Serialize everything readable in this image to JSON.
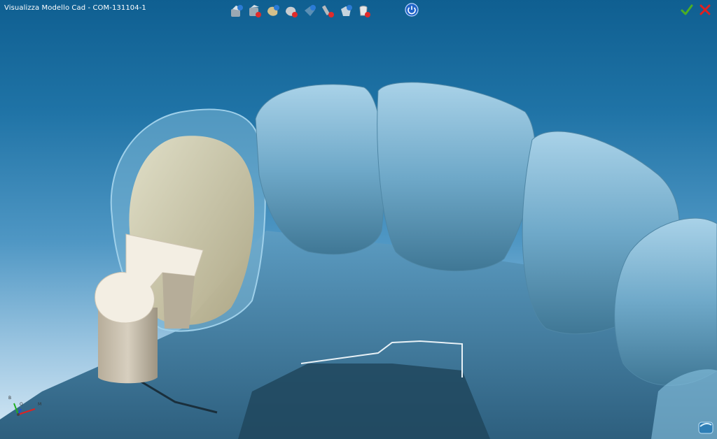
{
  "window": {
    "title": "Visualizza Modello Cad  - COM-131104-1"
  },
  "toolbar": {
    "tools": [
      {
        "icon": "model-view-icon"
      },
      {
        "icon": "model-remove-icon"
      },
      {
        "icon": "crown-view-icon"
      },
      {
        "icon": "crown-remove-icon"
      },
      {
        "icon": "abutment-view-icon"
      },
      {
        "icon": "implant-remove-icon"
      },
      {
        "icon": "scanbody-view-icon"
      },
      {
        "icon": "antagonist-remove-icon"
      }
    ],
    "power": {
      "icon": "power-icon"
    }
  },
  "actions": {
    "ok": {
      "icon": "checkmark-icon",
      "color": "#4caf23"
    },
    "cancel": {
      "icon": "close-icon",
      "color": "#e02020"
    }
  },
  "axis": {
    "labels": [
      "B",
      "O",
      "M"
    ]
  },
  "colors": {
    "model": "#6fa9c9",
    "model_dark": "#3b6f8f",
    "crown": "#d9cfae",
    "abutment": "#f2ede2"
  }
}
